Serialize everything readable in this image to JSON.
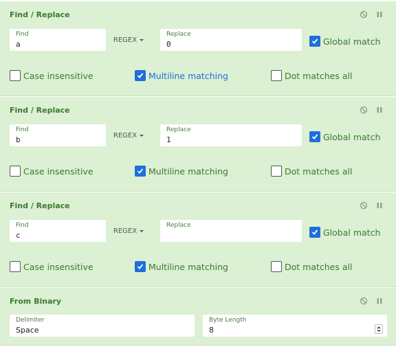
{
  "operations": [
    {
      "title": "Find / Replace",
      "find_label": "Find",
      "find_value": "a",
      "regex_label": "REGEX",
      "replace_label": "Replace",
      "replace_value": "0",
      "global_match": "Global match",
      "case_insensitive": "Case insensitive",
      "multiline": "Multiline matching",
      "dot_all": "Dot matches all",
      "checked": {
        "global_match": true,
        "case_insensitive": false,
        "multiline": true,
        "dot_all": false
      }
    },
    {
      "title": "Find / Replace",
      "find_label": "Find",
      "find_value": "b",
      "regex_label": "REGEX",
      "replace_label": "Replace",
      "replace_value": "1",
      "global_match": "Global match",
      "case_insensitive": "Case insensitive",
      "multiline": "Multiline matching",
      "dot_all": "Dot matches all",
      "checked": {
        "global_match": true,
        "case_insensitive": false,
        "multiline": true,
        "dot_all": false
      }
    },
    {
      "title": "Find / Replace",
      "find_label": "Find",
      "find_value": "c",
      "regex_label": "REGEX",
      "replace_label": "Replace",
      "replace_value": "",
      "global_match": "Global match",
      "case_insensitive": "Case insensitive",
      "multiline": "Multiline matching",
      "dot_all": "Dot matches all",
      "checked": {
        "global_match": true,
        "case_insensitive": false,
        "multiline": true,
        "dot_all": false
      }
    }
  ],
  "from_binary": {
    "title": "From Binary",
    "delimiter_label": "Delimiter",
    "delimiter_value": "Space",
    "byte_length_label": "Byte Length",
    "byte_length_value": "8"
  },
  "icons": {
    "disable": "disable-icon",
    "pause": "pause-icon",
    "check": "checkmark-icon"
  },
  "colors": {
    "panel_bg": "#dcf0d4",
    "accent": "#1e6fd9",
    "title": "#3a7a2e"
  }
}
